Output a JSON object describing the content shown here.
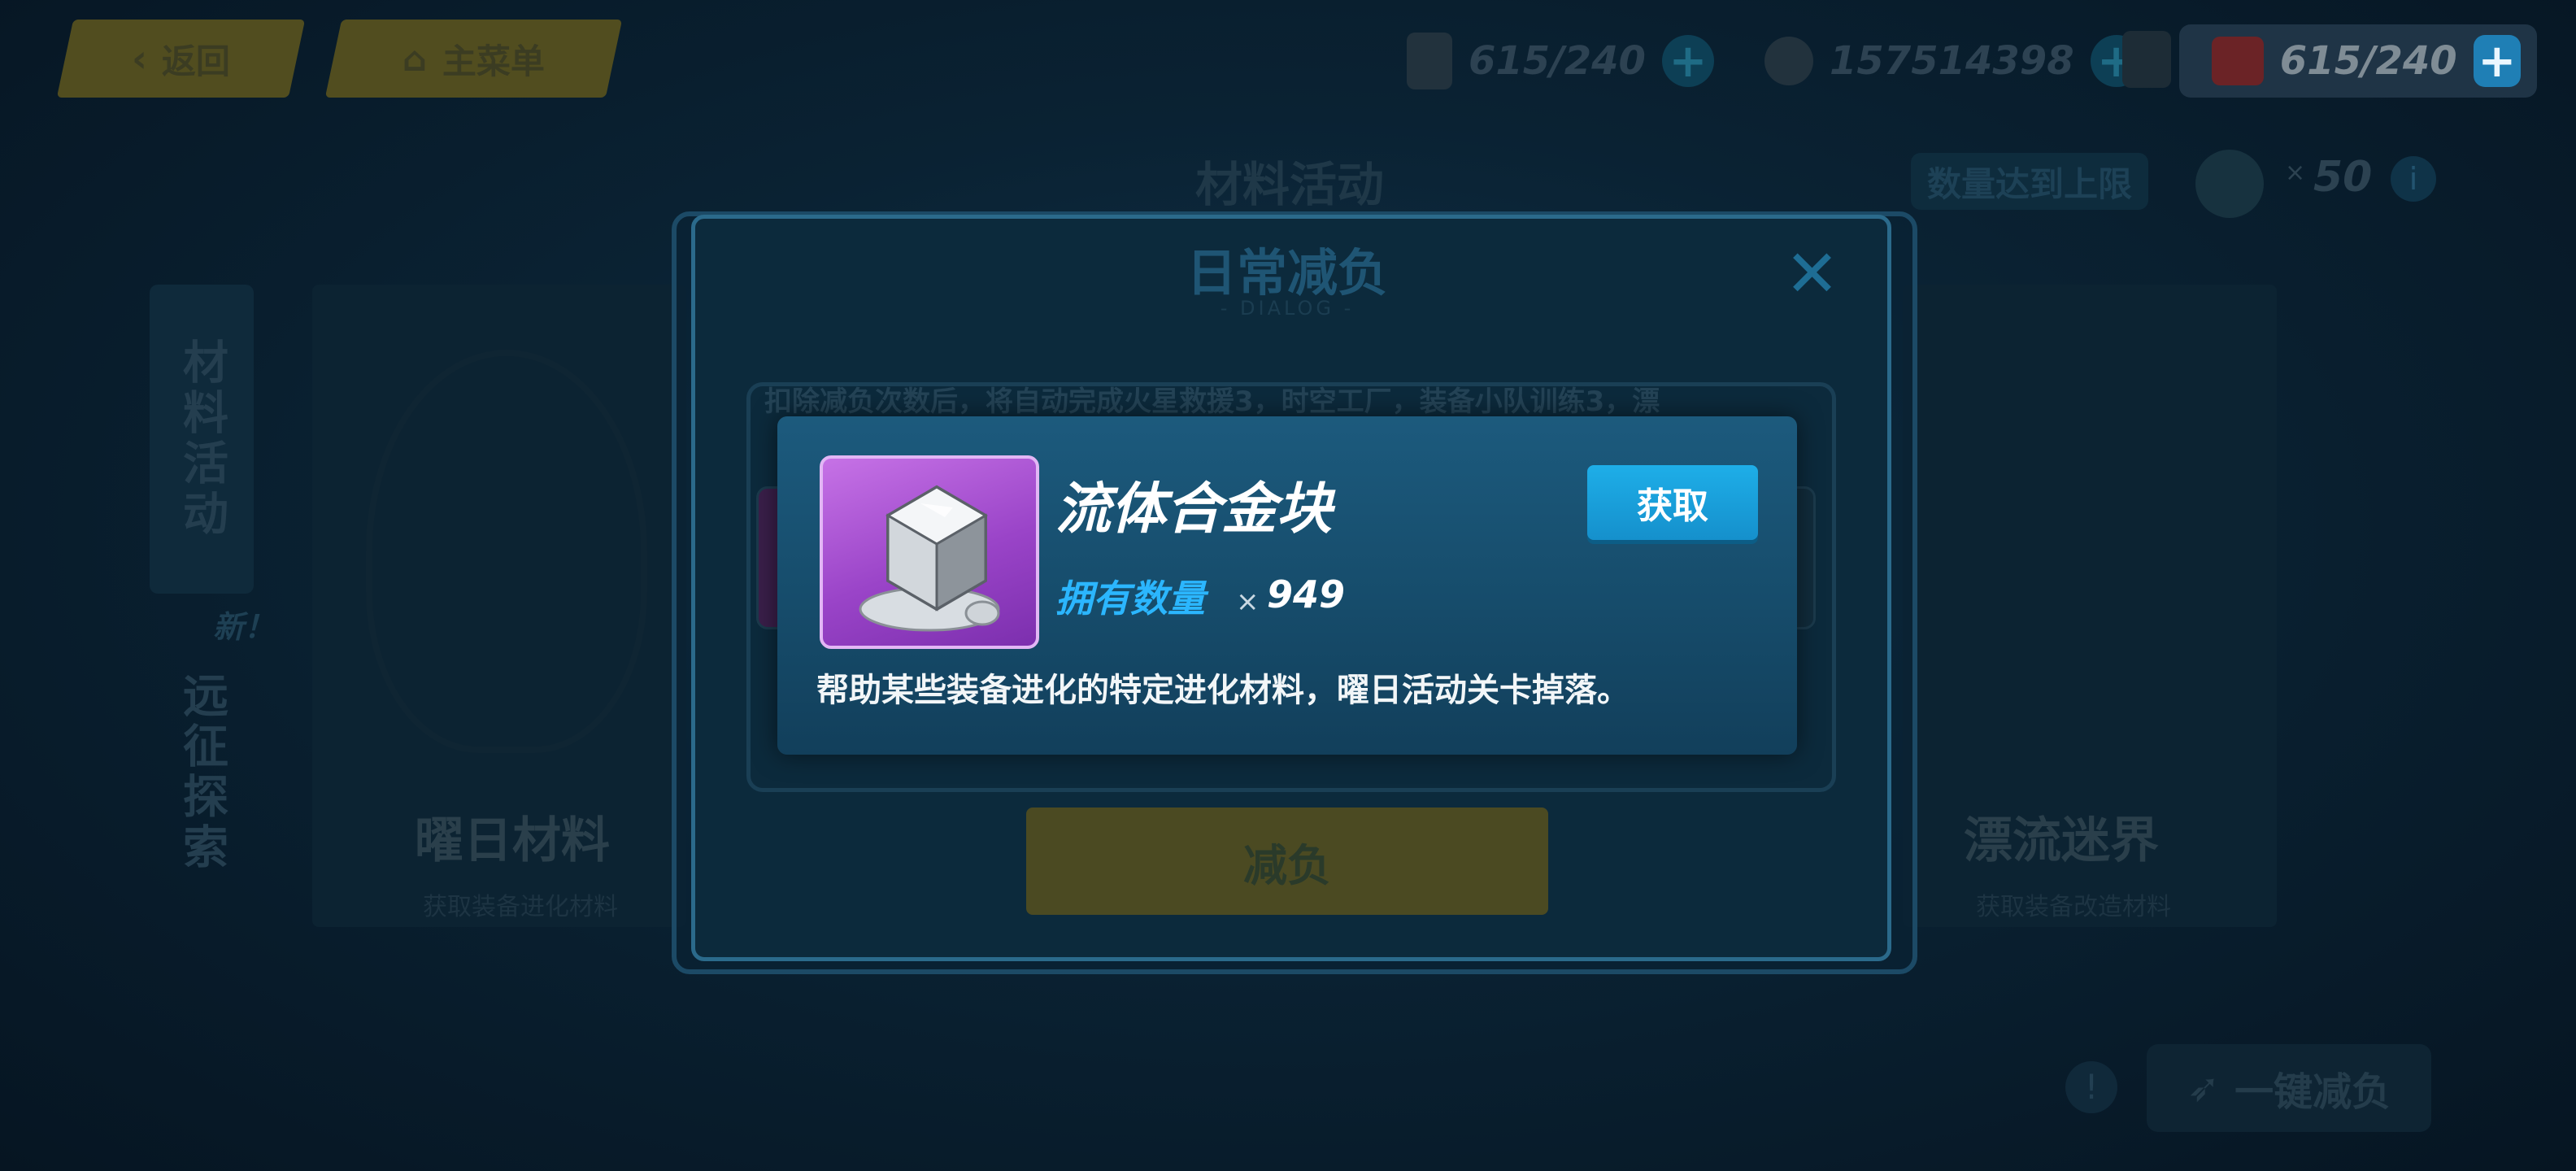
{
  "top_bar": {
    "back_label": "返回",
    "main_menu_label": "主菜单",
    "stamina_1": "615/240",
    "coins": "157514398",
    "stamina_2": "615/240"
  },
  "page": {
    "section_title": "材料活动",
    "limit_label": "数量达到上限",
    "limit_value": "50",
    "side_tabs": [
      "材料活动",
      "远征探索"
    ],
    "new_badge": "新！",
    "left_card_title": "曜日材料",
    "left_card_sub": "获取装备进化材料",
    "right_card_title": "漂流迷界",
    "right_card_sub": "获取装备改造材料",
    "one_click_label": "一键减负"
  },
  "dialog": {
    "title": "日常减负",
    "subtitle": "- DIALOG -",
    "hint": "扣除减负次数后，将自动完成火星救援3，时空工厂，装备小队训练3，漂",
    "reduce_label": "减负"
  },
  "popup": {
    "item_name": "流体合金块",
    "own_label": "拥有数量",
    "own_x": "×",
    "own_count": "949",
    "get_label": "获取",
    "description": "帮助某些装备进化的特定进化材料，曜日活动关卡掉落。"
  },
  "colors": {
    "accent_blue": "#1eaee8",
    "item_rarity_purple": "#9a44c8",
    "popup_bg": "#1c5a7d"
  }
}
